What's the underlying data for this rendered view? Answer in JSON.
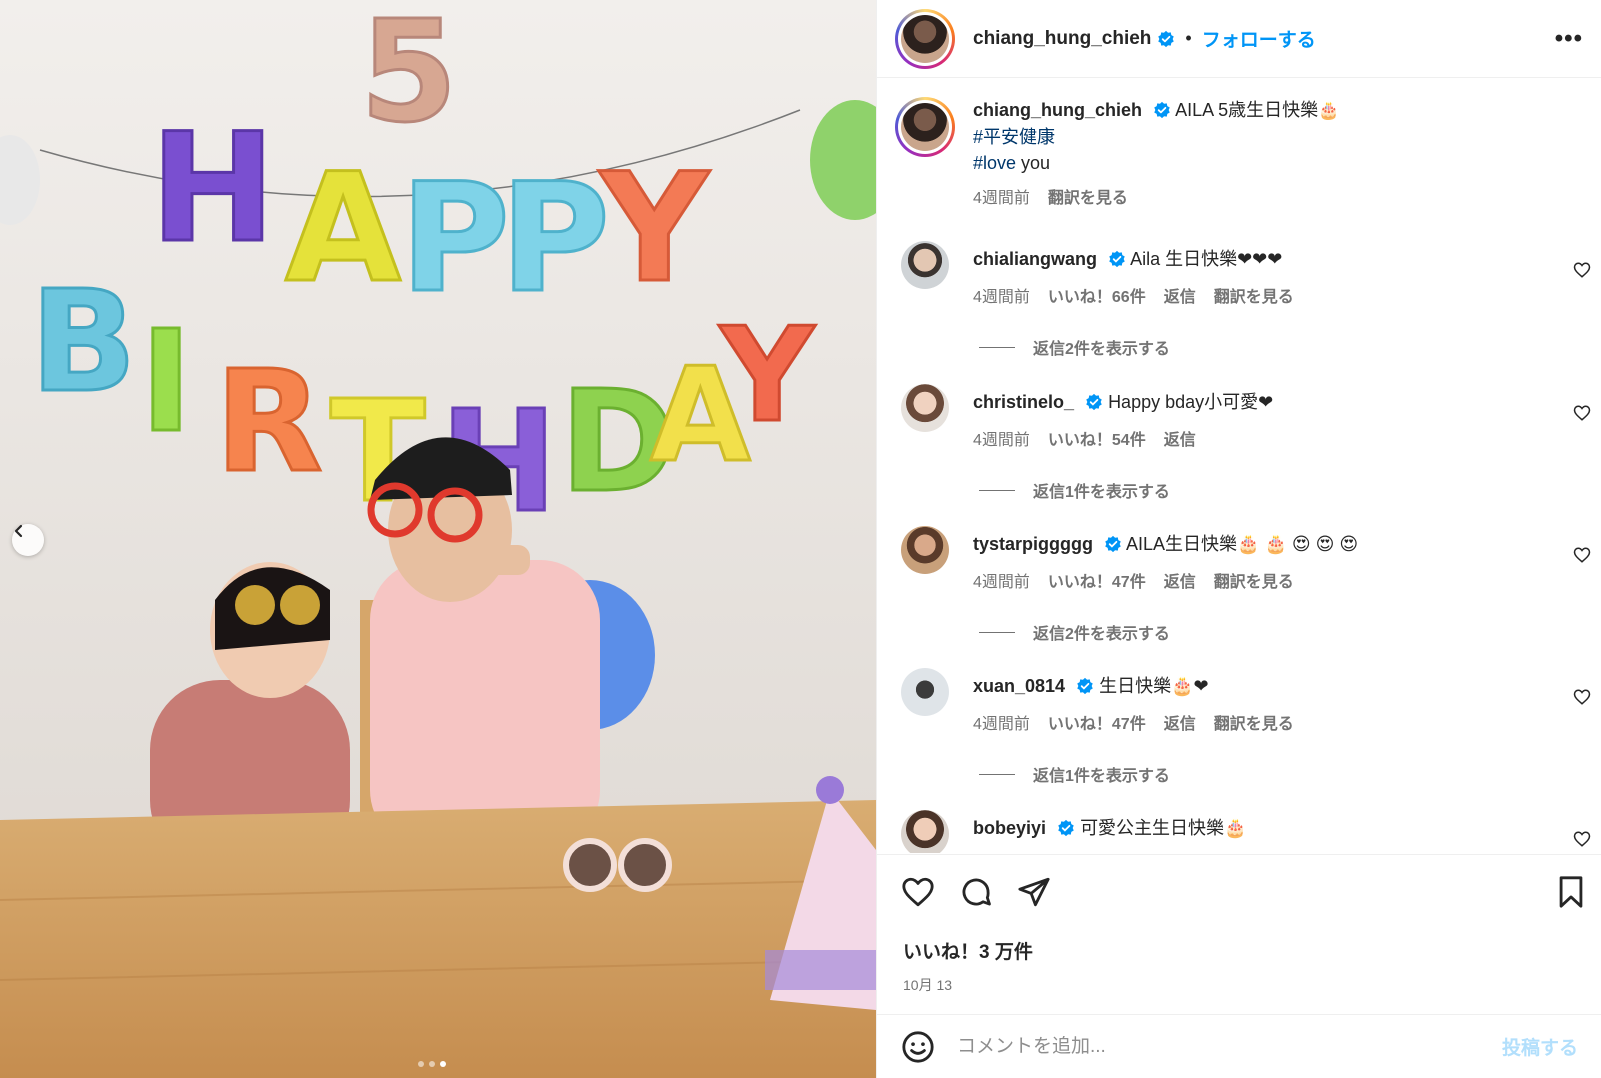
{
  "post": {
    "username": "chiang_hung_chieh",
    "follow_label": "フォローする",
    "more_label": "•••"
  },
  "caption": {
    "username": "chiang_hung_chieh",
    "text": "AILA 5歳生日快樂",
    "emoji": "🎂",
    "tag1": "#平安健康",
    "tag2": "#love",
    "tag2_rest": " you",
    "time": "4週間前",
    "translate": "翻訳を見る"
  },
  "comments": [
    {
      "username": "chialiangwang",
      "text": "Aila 生日快樂❤❤❤",
      "time": "4週間前",
      "likes": "いいね！66件",
      "reply": "返信",
      "translate": "翻訳を見る",
      "replies": "返信2件を表示する"
    },
    {
      "username": "christinelo_",
      "text": "Happy bday小可愛❤",
      "time": "4週間前",
      "likes": "いいね！54件",
      "reply": "返信",
      "translate": "",
      "replies": "返信1件を表示する"
    },
    {
      "username": "tystarpiggggg",
      "text": "AILA生日快樂🎂 🎂 😍 😍 😍",
      "time": "4週間前",
      "likes": "いいね！47件",
      "reply": "返信",
      "translate": "翻訳を見る",
      "replies": "返信2件を表示する"
    },
    {
      "username": "xuan_0814",
      "text": "生日快樂🎂❤",
      "time": "4週間前",
      "likes": "いいね！47件",
      "reply": "返信",
      "translate": "翻訳を見る",
      "replies": "返信1件を表示する"
    },
    {
      "username": "bobeyiyi",
      "text": "可愛公主生日快樂🎂",
      "time": "",
      "likes": "",
      "reply": "",
      "translate": "",
      "replies": ""
    }
  ],
  "likes_label": "いいね！3 万件",
  "date_label": "10月 13",
  "comment_input": {
    "placeholder": "コメントを追加...",
    "post_label": "投稿する"
  },
  "carousel": {
    "count": 3,
    "active": 3
  },
  "colors": {
    "accent": "#0095f6",
    "hashtag": "#00376b",
    "muted": "#737373"
  }
}
